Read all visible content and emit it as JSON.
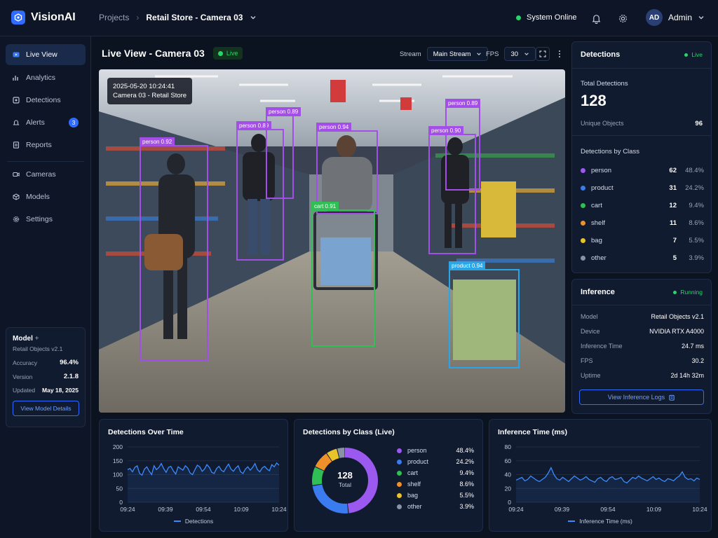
{
  "app": {
    "name": "VisionAI"
  },
  "breadcrumb": {
    "root": "Projects",
    "current": "Retail Store - Camera 03"
  },
  "header": {
    "status": "System Online",
    "user_initials": "AD",
    "user_name": "Admin"
  },
  "sidebar": {
    "items": [
      {
        "label": "Live View",
        "icon": "video-icon",
        "active": true
      },
      {
        "label": "Analytics",
        "icon": "bar-chart-icon"
      },
      {
        "label": "Detections",
        "icon": "target-icon"
      },
      {
        "label": "Alerts",
        "icon": "bell-icon",
        "badge": "3"
      },
      {
        "label": "Reports",
        "icon": "document-icon"
      },
      {
        "label": "Cameras",
        "icon": "camera-icon"
      },
      {
        "label": "Models",
        "icon": "cube-icon"
      },
      {
        "label": "Settings",
        "icon": "gear-icon"
      }
    ]
  },
  "model_card": {
    "title": "Model",
    "plus": "+",
    "name": "Retail Objects v2.1",
    "accuracy_label": "Accuracy",
    "accuracy": "96.4%",
    "version_label": "Version",
    "version": "2.1.8",
    "updated_label": "Updated",
    "updated": "May 18, 2025",
    "button": "View Model Details"
  },
  "live_view": {
    "title": "Live View - Camera 03",
    "live_label": "Live",
    "stream_label": "Stream",
    "stream_value": "Main Stream",
    "fps_label": "FPS",
    "fps_value": "30",
    "timestamp": "2025-05-20 10:24:41",
    "camera_name": "Camera 03 - Retail Store",
    "detections": [
      {
        "label": "person 0.92",
        "color": "#a34ee6"
      },
      {
        "label": "person 0.89",
        "color": "#a34ee6"
      },
      {
        "label": "person 0.89",
        "color": "#a34ee6"
      },
      {
        "label": "person 0.94",
        "color": "#a34ee6"
      },
      {
        "label": "person 0.89",
        "color": "#a34ee6"
      },
      {
        "label": "person 0.90",
        "color": "#a34ee6"
      },
      {
        "label": "cart 0.91",
        "color": "#2fbf55"
      },
      {
        "label": "product 0.94",
        "color": "#2aa6e8"
      }
    ]
  },
  "detections_panel": {
    "title": "Detections",
    "status": "Live",
    "total_label": "Total Detections",
    "total": "128",
    "unique_label": "Unique Objects",
    "unique": "96",
    "by_class_label": "Detections by Class",
    "classes": [
      {
        "name": "person",
        "count": "62",
        "pct": "48.4%",
        "color": "#9b59f0"
      },
      {
        "name": "product",
        "count": "31",
        "pct": "24.2%",
        "color": "#3a7bf0"
      },
      {
        "name": "cart",
        "count": "12",
        "pct": "9.4%",
        "color": "#2fbf55"
      },
      {
        "name": "shelf",
        "count": "11",
        "pct": "8.6%",
        "color": "#f0902a"
      },
      {
        "name": "bag",
        "count": "7",
        "pct": "5.5%",
        "color": "#e8c42a"
      },
      {
        "name": "other",
        "count": "5",
        "pct": "3.9%",
        "color": "#8a93a3"
      }
    ]
  },
  "inference_panel": {
    "title": "Inference",
    "status": "Running",
    "rows": [
      {
        "label": "Model",
        "value": "Retail Objects v2.1"
      },
      {
        "label": "Device",
        "value": "NVIDIA RTX A4000"
      },
      {
        "label": "Inference Time",
        "value": "24.7 ms"
      },
      {
        "label": "FPS",
        "value": "30.2"
      },
      {
        "label": "Uptime",
        "value": "2d 14h 32m"
      }
    ],
    "button": "View Inference Logs"
  },
  "chart_data": [
    {
      "type": "line",
      "title": "Detections Over Time",
      "legend": "Detections",
      "ylim": [
        0,
        200
      ],
      "yticks": [
        "200",
        "150",
        "100",
        "50",
        "0"
      ],
      "xticks": [
        "09:24",
        "09:39",
        "09:54",
        "10:09",
        "10:24"
      ],
      "values": [
        118,
        122,
        110,
        126,
        132,
        104,
        98,
        120,
        128,
        112,
        100,
        132,
        118,
        126,
        140,
        122,
        108,
        126,
        130,
        114,
        102,
        128,
        122,
        116,
        132,
        124,
        106,
        100,
        118,
        134,
        128,
        112,
        120,
        136,
        126,
        108,
        104,
        122,
        130,
        116,
        110,
        126,
        138,
        120,
        112,
        124,
        132,
        110,
        104,
        120,
        128,
        116,
        126,
        140,
        118,
        110,
        124,
        130,
        120,
        114,
        136,
        128,
        142,
        134
      ]
    },
    {
      "type": "pie",
      "title": "Detections by Class (Live)",
      "center_value": "128",
      "center_label": "Total",
      "categories": [
        "person",
        "product",
        "cart",
        "shelf",
        "bag",
        "other"
      ],
      "values": [
        48.4,
        24.2,
        9.4,
        8.6,
        5.5,
        3.9
      ],
      "labels": [
        "48.4%",
        "24.2%",
        "9.4%",
        "8.6%",
        "5.5%",
        "3.9%"
      ],
      "colors": [
        "#9b59f0",
        "#3a7bf0",
        "#2fbf55",
        "#f0902a",
        "#e8c42a",
        "#8a93a3"
      ]
    },
    {
      "type": "line",
      "title": "Inference Time (ms)",
      "legend": "Inference Time (ms)",
      "ylim": [
        0,
        80
      ],
      "yticks": [
        "80",
        "60",
        "40",
        "20",
        "0"
      ],
      "xticks": [
        "09:24",
        "09:39",
        "09:54",
        "10:09",
        "10:24"
      ],
      "values": [
        32,
        34,
        36,
        31,
        33,
        38,
        35,
        32,
        30,
        33,
        36,
        42,
        50,
        40,
        34,
        32,
        36,
        33,
        30,
        34,
        38,
        35,
        32,
        34,
        37,
        33,
        31,
        29,
        34,
        36,
        32,
        30,
        35,
        37,
        33,
        34,
        36,
        30,
        28,
        32,
        36,
        34,
        38,
        35,
        33,
        31,
        34,
        37,
        33,
        35,
        32,
        30,
        34,
        33,
        31,
        35,
        38,
        44,
        36,
        33,
        34,
        31,
        35,
        33
      ]
    }
  ]
}
